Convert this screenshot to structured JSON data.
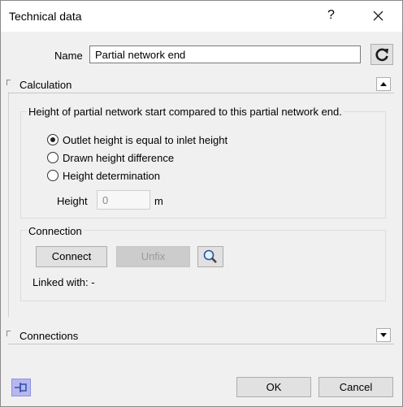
{
  "window": {
    "title": "Technical data",
    "help_label": "?"
  },
  "name": {
    "label": "Name",
    "value": "Partial network end"
  },
  "calculation": {
    "header": "Calculation",
    "description": "Height of partial network start compared to this partial network end.",
    "options": [
      {
        "label": "Outlet height is equal to inlet height",
        "checked": true
      },
      {
        "label": "Drawn height difference",
        "checked": false
      },
      {
        "label": "Height determination",
        "checked": false
      }
    ],
    "height_label": "Height",
    "height_value": "0",
    "height_unit": "m"
  },
  "connection": {
    "title": "Connection",
    "connect_label": "Connect",
    "unfix_label": "Unfix",
    "linked_label": "Linked with: -"
  },
  "connections": {
    "header": "Connections"
  },
  "footer": {
    "ok_label": "OK",
    "cancel_label": "Cancel"
  },
  "colors": {
    "pin_button_bg": "#b7b7f0",
    "icon_blue": "#2f4fa8"
  }
}
